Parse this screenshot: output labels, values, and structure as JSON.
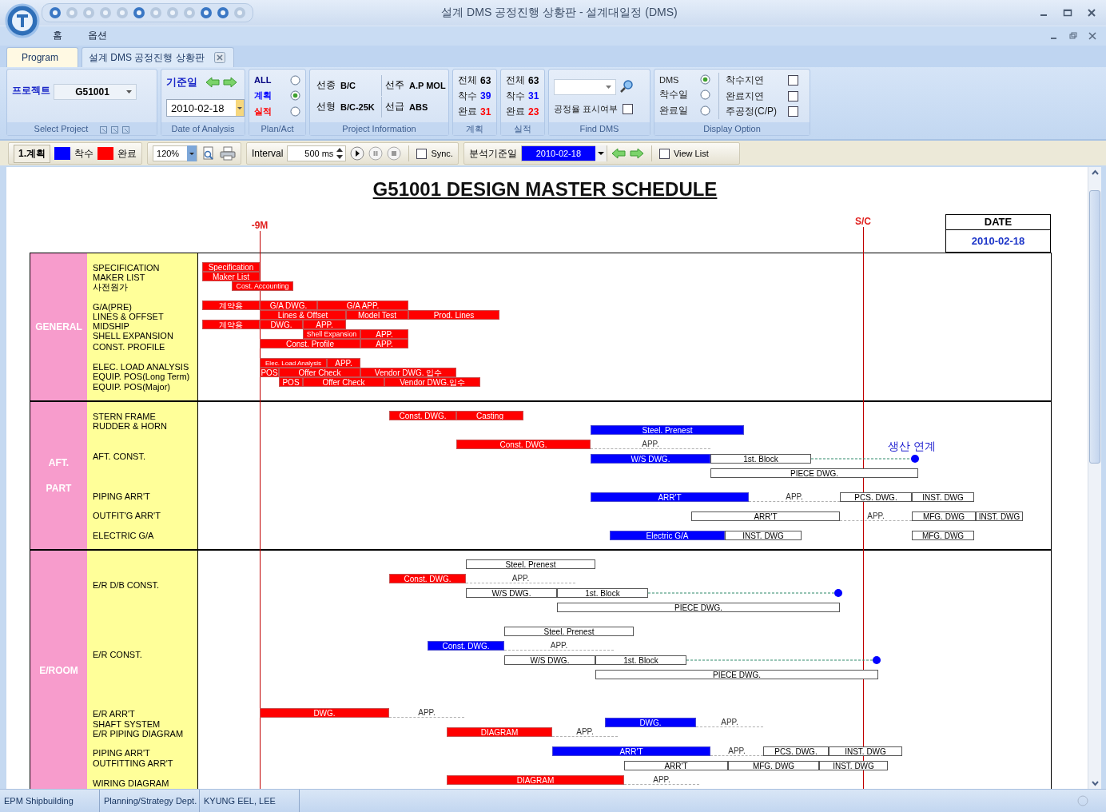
{
  "window": {
    "title": "설계 DMS 공정진행 상황판 - 설계대일정 (DMS)"
  },
  "menu": [
    {
      "label": "홈"
    },
    {
      "label": "옵션"
    }
  ],
  "tabs": [
    {
      "label": "Program",
      "selected": false
    },
    {
      "label": "설계 DMS 공정진행 상황판",
      "selected": true
    }
  ],
  "ribbon": {
    "select_project": {
      "label": "프로젝트",
      "value": "G51001",
      "caption": "Select Project"
    },
    "date_of_analysis": {
      "label": "기준일",
      "value": "2010-02-18",
      "caption": "Date of Analysis"
    },
    "plan_act": {
      "caption": "Plan/Act",
      "options": [
        {
          "label": "ALL",
          "selected": false,
          "color": "#000080"
        },
        {
          "label": "계획",
          "selected": true,
          "color": "#0000ff"
        },
        {
          "label": "실적",
          "selected": false,
          "color": "#ff0000"
        }
      ]
    },
    "project_info": {
      "caption": "Project Information",
      "items": [
        {
          "label": "선종",
          "value": "B/C"
        },
        {
          "label": "선주",
          "value": "A.P MOL"
        },
        {
          "label": "선형",
          "value": "B/C-25K"
        },
        {
          "label": "선급",
          "value": "ABS"
        }
      ]
    },
    "plan_counts": {
      "caption": "계획",
      "items": [
        {
          "label": "전체",
          "value": "63",
          "color": "#000000"
        },
        {
          "label": "착수",
          "value": "39",
          "color": "#0000ff"
        },
        {
          "label": "완료",
          "value": "31",
          "color": "#ff0000"
        }
      ]
    },
    "actual_counts": {
      "caption": "실적",
      "items": [
        {
          "label": "전체",
          "value": "63",
          "color": "#000000"
        },
        {
          "label": "착수",
          "value": "31",
          "color": "#0000ff"
        },
        {
          "label": "완료",
          "value": "23",
          "color": "#ff0000"
        }
      ]
    },
    "find_dms": {
      "caption": "Find DMS",
      "checkbox": {
        "label": "공정율 표시여부",
        "checked": false
      }
    },
    "display_option": {
      "caption": "Display Option",
      "radios": [
        {
          "label": "DMS",
          "selected": true
        },
        {
          "label": "착수일",
          "selected": false
        },
        {
          "label": "완료일",
          "selected": false
        }
      ],
      "checks": [
        {
          "label": "착수지연",
          "checked": false
        },
        {
          "label": "완료지연",
          "checked": false
        },
        {
          "label": "주공정(C/P)",
          "checked": false
        }
      ]
    }
  },
  "toolbar": {
    "mode": "1.계획",
    "legend": [
      {
        "label": "착수",
        "color": "#0000ff"
      },
      {
        "label": "완료",
        "color": "#ff0000"
      }
    ],
    "zoom": "120%",
    "interval_label": "Interval",
    "interval": "500 ms",
    "sync": {
      "label": "Sync.",
      "checked": false
    },
    "analysis_date_label": "분석기준일",
    "analysis_date": "2010-02-18",
    "view_list": {
      "label": "View List",
      "checked": false
    }
  },
  "schedule": {
    "title": "G51001 DESIGN MASTER SCHEDULE",
    "markers": [
      {
        "label": "-9M"
      },
      {
        "label": "S/C"
      }
    ],
    "date_header": "DATE",
    "date": "2010-02-18",
    "note": "생산 연계",
    "sections": [
      {
        "name": "GENERAL",
        "rows": [
          "SPECIFICATION",
          "MAKER LIST",
          "사전원가",
          "G/A(PRE)",
          "LINES & OFFSET",
          "MIDSHIP",
          "SHELL EXPANSION",
          "CONST. PROFILE",
          "ELEC. LOAD ANALYSIS",
          "EQUIP. POS(Long Term)",
          "EQUIP. POS(Major)"
        ],
        "bars": [
          {
            "label": "Specification",
            "kind": "plan"
          },
          {
            "label": "Maker List",
            "kind": "plan"
          },
          {
            "label": "Cost. Accounting",
            "kind": "plan"
          },
          {
            "label": "계약용",
            "kind": "plan"
          },
          {
            "label": "G/A DWG.",
            "kind": "plan"
          },
          {
            "label": "G/A APP.",
            "kind": "plan"
          },
          {
            "label": "Lines & Offset",
            "kind": "plan"
          },
          {
            "label": "Model Test",
            "kind": "plan"
          },
          {
            "label": "Prod. Lines",
            "kind": "plan"
          },
          {
            "label": "계약용",
            "kind": "plan"
          },
          {
            "label": "DWG.",
            "kind": "plan"
          },
          {
            "label": "APP.",
            "kind": "plan"
          },
          {
            "label": "Shell Expansion",
            "kind": "plan"
          },
          {
            "label": "APP.",
            "kind": "plan"
          },
          {
            "label": "Const. Profile",
            "kind": "plan"
          },
          {
            "label": "APP.",
            "kind": "plan"
          },
          {
            "label": "Elec. Load Analysis",
            "kind": "plan"
          },
          {
            "label": "APP.",
            "kind": "plan"
          },
          {
            "label": "POS",
            "kind": "plan"
          },
          {
            "label": "Offer Check",
            "kind": "plan"
          },
          {
            "label": "Vendor DWG. 입수",
            "kind": "plan"
          },
          {
            "label": "POS",
            "kind": "plan"
          },
          {
            "label": "Offer Check",
            "kind": "plan"
          },
          {
            "label": "Vendor DWG.입수",
            "kind": "plan"
          }
        ]
      },
      {
        "name": "AFT.\nPART",
        "rows": [
          "STERN FRAME",
          "RUDDER & HORN",
          "AFT. CONST.",
          "PIPING ARR'T",
          "OUTFIT'G ARR'T",
          "ELECTRIC G/A"
        ],
        "bars": [
          {
            "label": "Const. DWG.",
            "kind": "plan"
          },
          {
            "label": "Casting",
            "kind": "plan"
          },
          {
            "label": "Steel. Prenest",
            "kind": "actual"
          },
          {
            "label": "Const. DWG.",
            "kind": "plan"
          },
          {
            "label": "APP.",
            "kind": "pending"
          },
          {
            "label": "W/S DWG.",
            "kind": "actual"
          },
          {
            "label": "1st. Block",
            "kind": "open"
          },
          {
            "kind": "link"
          },
          {
            "label": "PIECE DWG.",
            "kind": "open"
          },
          {
            "label": "ARR'T",
            "kind": "actual"
          },
          {
            "label": "APP.",
            "kind": "pending"
          },
          {
            "label": "PCS. DWG.",
            "kind": "open"
          },
          {
            "label": "INST. DWG",
            "kind": "open"
          },
          {
            "label": "ARR'T",
            "kind": "open"
          },
          {
            "label": "APP.",
            "kind": "pending"
          },
          {
            "label": "MFG. DWG",
            "kind": "open"
          },
          {
            "label": "INST. DWG",
            "kind": "open"
          },
          {
            "label": "Electric G/A",
            "kind": "actual"
          },
          {
            "label": "INST. DWG",
            "kind": "open"
          },
          {
            "label": "MFG. DWG",
            "kind": "open"
          }
        ]
      },
      {
        "name": "E/ROOM",
        "rows": [
          "E/R D/B CONST.",
          "E/R CONST.",
          "E/R ARR'T",
          "SHAFT SYSTEM",
          "E/R PIPING DIAGRAM",
          "PIPING ARR'T",
          "OUTFITTING ARR'T",
          "WIRING DIAGRAM"
        ],
        "bars": [
          {
            "label": "Steel. Prenest",
            "kind": "open"
          },
          {
            "label": "Const. DWG.",
            "kind": "plan"
          },
          {
            "label": "APP.",
            "kind": "pending"
          },
          {
            "label": "W/S DWG.",
            "kind": "open"
          },
          {
            "label": "1st. Block",
            "kind": "open"
          },
          {
            "kind": "link"
          },
          {
            "label": "PIECE DWG.",
            "kind": "open"
          },
          {
            "label": "Steel. Prenest",
            "kind": "open"
          },
          {
            "label": "Const. DWG.",
            "kind": "actual"
          },
          {
            "label": "APP.",
            "kind": "pending"
          },
          {
            "label": "W/S DWG.",
            "kind": "open"
          },
          {
            "label": "1st. Block",
            "kind": "open"
          },
          {
            "kind": "link"
          },
          {
            "label": "PIECE DWG.",
            "kind": "open"
          },
          {
            "label": "DWG.",
            "kind": "plan"
          },
          {
            "label": "APP.",
            "kind": "pending"
          },
          {
            "label": "DWG.",
            "kind": "actual"
          },
          {
            "label": "APP.",
            "kind": "pending"
          },
          {
            "label": "DIAGRAM",
            "kind": "plan"
          },
          {
            "label": "APP.",
            "kind": "pending"
          },
          {
            "label": "ARR'T",
            "kind": "actual"
          },
          {
            "label": "APP.",
            "kind": "pending"
          },
          {
            "label": "PCS. DWG.",
            "kind": "open"
          },
          {
            "label": "INST. DWG",
            "kind": "open"
          },
          {
            "label": "ARR'T",
            "kind": "open"
          },
          {
            "label": "MFG. DWG",
            "kind": "open"
          },
          {
            "label": "INST. DWG",
            "kind": "open"
          },
          {
            "label": "DIAGRAM",
            "kind": "plan"
          },
          {
            "label": "APP.",
            "kind": "pending"
          }
        ]
      }
    ]
  },
  "status_bar": [
    "EPM Shipbuilding",
    "Planning/Strategy Dept.",
    "KYUNG EEL, LEE"
  ]
}
